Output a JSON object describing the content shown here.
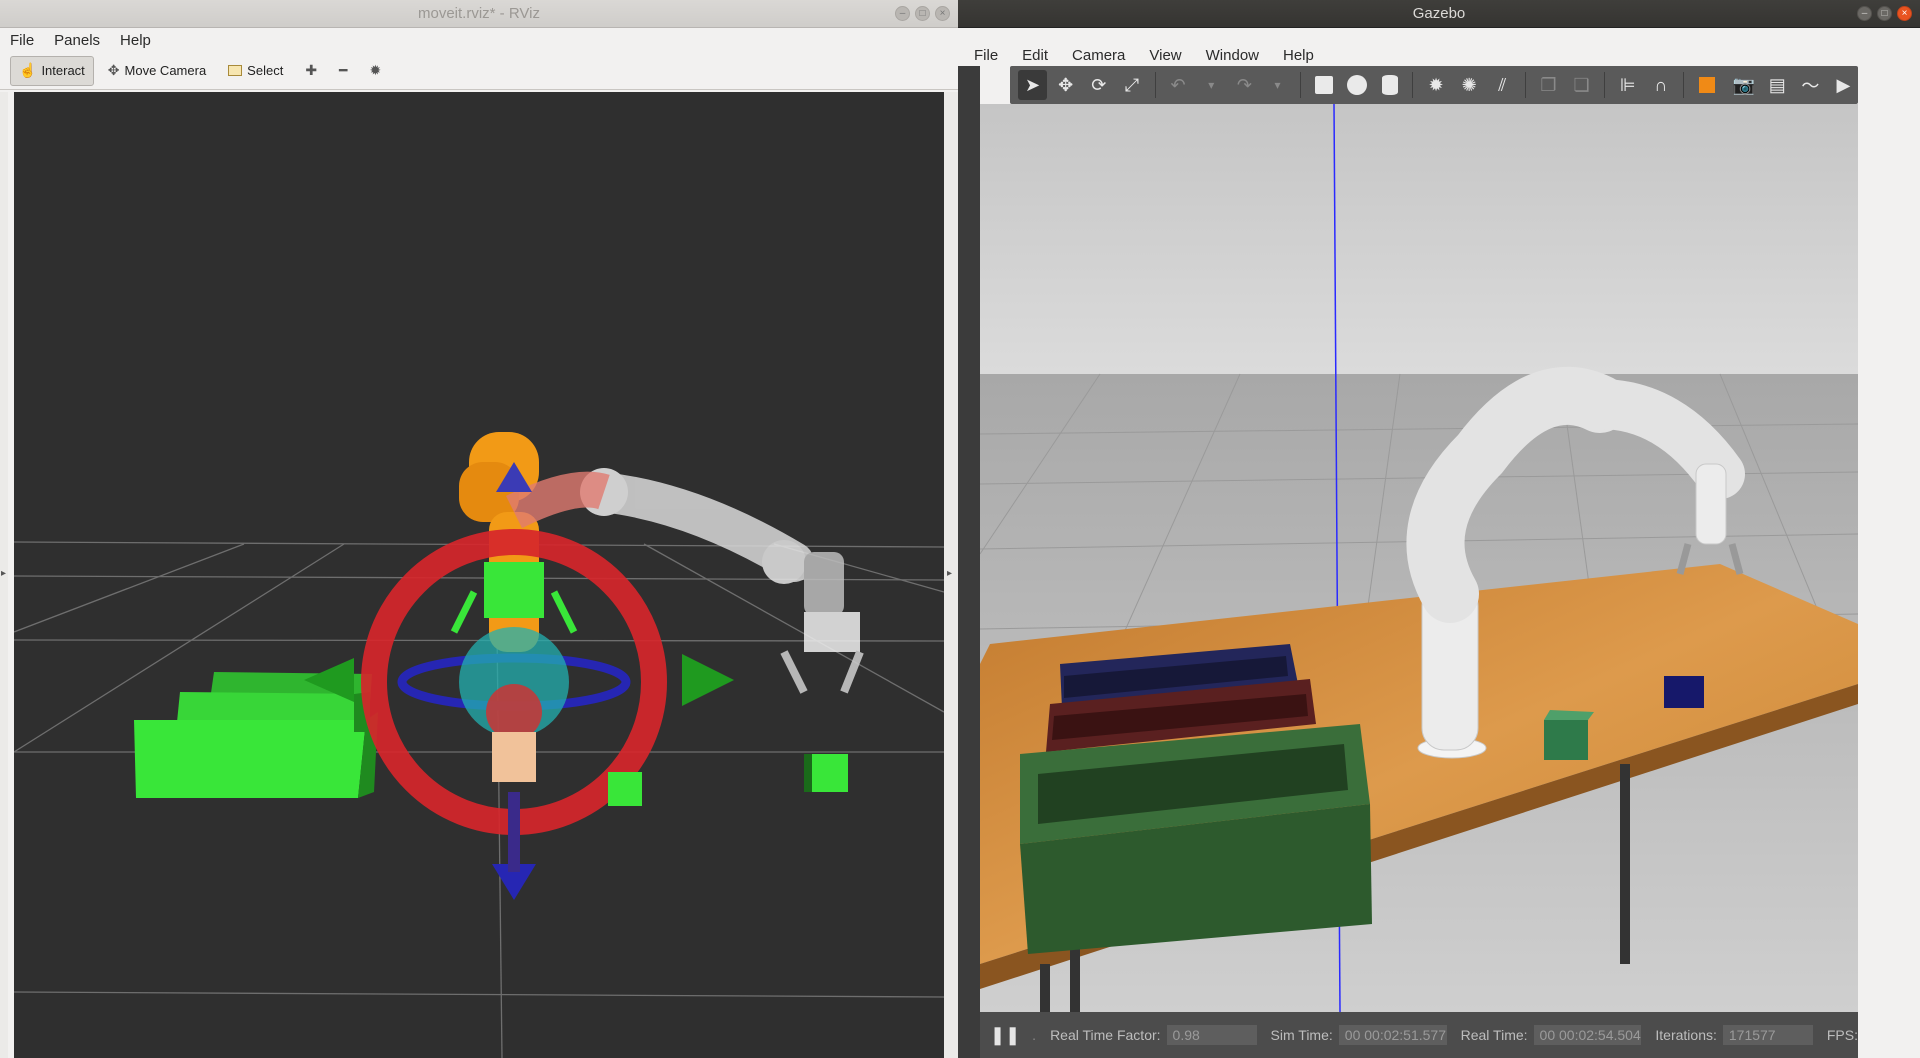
{
  "rviz": {
    "title": "moveit.rviz* - RViz",
    "menu": [
      "File",
      "Panels",
      "Help"
    ],
    "toolbar": {
      "interact": "Interact",
      "move_camera": "Move Camera",
      "select": "Select"
    }
  },
  "gazebo": {
    "title": "Gazebo",
    "menu": [
      "File",
      "Edit",
      "Camera",
      "View",
      "Window",
      "Help"
    ],
    "status": {
      "rtf_label": "Real Time Factor:",
      "rtf_value": "0.98",
      "sim_label": "Sim Time:",
      "sim_value": "00 00:02:51.577",
      "real_label": "Real Time:",
      "real_value": "00 00:02:54.504",
      "iter_label": "Iterations:",
      "iter_value": "171577",
      "fps_label": "FPS:"
    }
  },
  "colors": {
    "grid": "#6e6e6e",
    "marker_green": "#39e639",
    "marker_red": "#d6262b",
    "marker_blue": "#2626b3",
    "robot_orange": "#f29a16",
    "table_wood": "#cf8a3a",
    "bin_green": "#2d5a2d",
    "bin_red": "#5a2020",
    "bin_blue": "#23265a"
  }
}
